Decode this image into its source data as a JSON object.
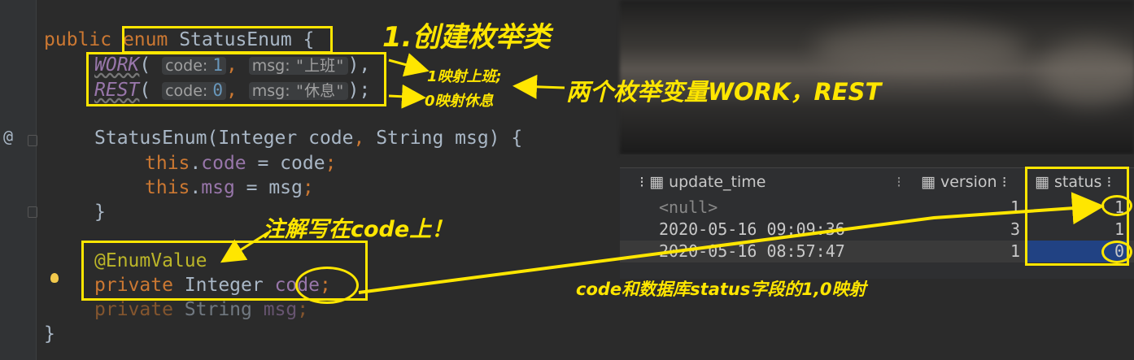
{
  "editor": {
    "gutter_sign": "@",
    "line1": {
      "kw": "public",
      "enum_kw": "enum",
      "name": "StatusEnum",
      "brace": " {"
    },
    "line2": {
      "name": "WORK",
      "open": "(",
      "hint_code": "code:",
      "code_val": "1",
      "comma": ",",
      "hint_msg": "msg:",
      "msg_val": "\"上班\"",
      "close": "),"
    },
    "line3": {
      "name": "REST",
      "open": "(",
      "hint_code": "code:",
      "code_val": "0",
      "comma": ",",
      "hint_msg": "msg:",
      "msg_val": "\"休息\"",
      "close": ");"
    },
    "line4": {
      "text": "StatusEnum(Integer code",
      "comma": ",",
      "text2": " String msg) {"
    },
    "line5": {
      "this": "this",
      "dot": ".",
      "field": "code",
      "rest": " = code",
      "semi": ";"
    },
    "line6": {
      "this": "this",
      "dot": ".",
      "field": "msg",
      "rest": " = msg",
      "semi": ";"
    },
    "line7": {
      "text": "}"
    },
    "line8": {
      "text": "@EnumValue"
    },
    "line9": {
      "kw": "private",
      "type": " Integer ",
      "field": "code",
      "semi": ";"
    },
    "line10": {
      "kw": "private",
      "type": " String ",
      "field": "msg",
      "semi": ";"
    },
    "line11": {
      "text": "}"
    }
  },
  "db": {
    "columns": [
      "update_time",
      "version",
      "status"
    ],
    "rows": [
      {
        "update_time": "<null>",
        "version": "1",
        "status": "1"
      },
      {
        "update_time": "2020-05-16 09:09:36",
        "version": "3",
        "status": "1"
      },
      {
        "update_time": "2020-05-16 08:57:47",
        "version": "1",
        "status": "0"
      }
    ]
  },
  "annotations": {
    "create_enum": "1.创建枚举类",
    "map1": "1映射上班;",
    "map0": "0映射休息",
    "two_vars": "两个枚举变量WORK，REST",
    "on_code": "注解写在code上！",
    "db_map": "code和数据库status字段的1,0映射"
  },
  "colors": {
    "annotation": "#ffe600",
    "selection": "#214283",
    "keyword": "#cc7832",
    "number": "#6897bb"
  }
}
